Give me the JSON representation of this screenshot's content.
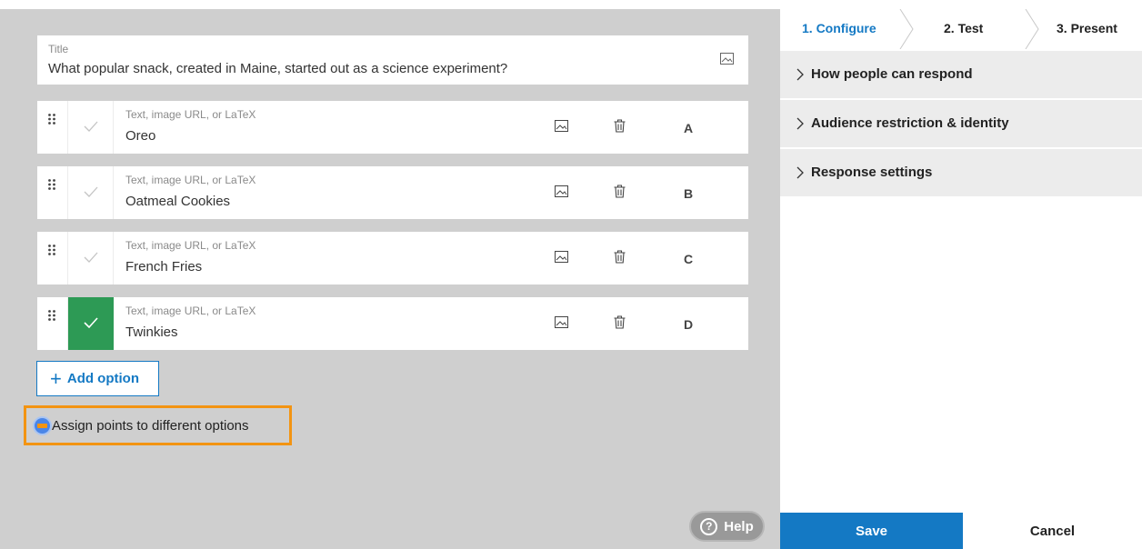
{
  "title_field": {
    "label": "Title",
    "value": "What popular snack, created in Maine, started out as a science experiment?"
  },
  "options": [
    {
      "placeholder": "Text, image URL, or LaTeX",
      "value": "Oreo",
      "letter": "A",
      "correct": false
    },
    {
      "placeholder": "Text, image URL, or LaTeX",
      "value": "Oatmeal Cookies",
      "letter": "B",
      "correct": false
    },
    {
      "placeholder": "Text, image URL, or LaTeX",
      "value": "French Fries",
      "letter": "C",
      "correct": false
    },
    {
      "placeholder": "Text, image URL, or LaTeX",
      "value": "Twinkies",
      "letter": "D",
      "correct": true
    }
  ],
  "add_option_label": "Add option",
  "assign_points_label": "Assign points to different options",
  "help_label": "Help",
  "steps": [
    {
      "label": "1. Configure",
      "active": true
    },
    {
      "label": "2. Test",
      "active": false
    },
    {
      "label": "3. Present",
      "active": false
    }
  ],
  "accordion": [
    {
      "label": "How people can respond"
    },
    {
      "label": "Audience restriction & identity"
    },
    {
      "label": "Response settings"
    }
  ],
  "save_label": "Save",
  "cancel_label": "Cancel",
  "colors": {
    "accent": "#1479c4",
    "correct": "#2d9a55",
    "highlight": "#f39412"
  },
  "icons": [
    "drag-handle-icon",
    "check-icon",
    "image-icon",
    "trash-icon",
    "plus-icon",
    "help-icon",
    "chevron-right-icon"
  ]
}
